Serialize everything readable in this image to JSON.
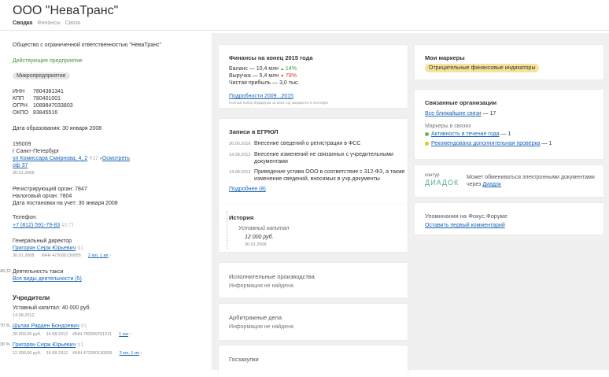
{
  "header": {
    "title": "ООО \"НеваТранс\"",
    "tabs": [
      "Сводка",
      "Финансы",
      "Связи"
    ]
  },
  "left": {
    "full_name": "Общество с ограниченной ответственностью \"НеваТранс\"",
    "status": "Действующее предприятие",
    "category": "Микропредприятие",
    "ids": [
      {
        "k": "ИНН",
        "v": "7804381341"
      },
      {
        "k": "КПП",
        "v": "780401001"
      },
      {
        "k": "ОГРН",
        "v": "1089847033803"
      },
      {
        "k": "ОКПО",
        "v": "83845516"
      }
    ],
    "formation_date": "Дата образования: 30 января 2008",
    "address": {
      "zip": "195009",
      "city": "г Санкт-Петербург",
      "street": "ул Комиссара Смирнова, 4, 2",
      "show": "Осмотреть",
      "office": "оф 37",
      "count": "17",
      "date": "30.01.2008"
    },
    "reg": {
      "reg_organ": "Регистрирующий орган: 7847",
      "tax_organ": "Налоговый орган: 7804",
      "tax_date": "Дата постановки на учет: 30 января 2008"
    },
    "phone": {
      "label": "Телефон:",
      "value": "+7 (812) 591-79-83",
      "count": "2"
    },
    "director": {
      "label": "Генеральный директор",
      "name": "Григорян Серж Юрьевич",
      "count": "1",
      "date": "30.01.2008",
      "inn": "ИНН 472000130055",
      "links": "2 юл, 1 ип"
    },
    "activity": {
      "pct": "49.32",
      "name": "Деятельность такси",
      "all": "Все виды деятельности (5)"
    },
    "founders": {
      "title": "Учредители",
      "capital": "Уставный капитал: 40 000 руб.",
      "date": "14.08.2012",
      "items": [
        {
          "pct": "70 %",
          "name": "Шулая Рарден Бондоевич",
          "count": "1",
          "sum": "28 000,00 руб.",
          "date": "14.08.2012",
          "inn": "ИНН 783909761211",
          "links": "1 юл"
        },
        {
          "pct": "30 %",
          "name": "Григорян Серж Юрьевич",
          "count": "1",
          "sum": "12 000,00 руб.",
          "date": "14.08.2012",
          "inn": "ИНН 472000130055",
          "links": "2 юл, 1 ип"
        }
      ]
    }
  },
  "finance": {
    "title": "Финансы на конец 2015 года",
    "rows": [
      {
        "label": "Баланс — 10,4 млн",
        "dir": "up",
        "delta": "14%"
      },
      {
        "label": "Выручка — 5,4 млн",
        "dir": "down",
        "delta": "78%"
      },
      {
        "label": "Чистая прибыль — 3,0 тыс.",
        "dir": "",
        "delta": ""
      }
    ],
    "details": "Подробности 2009...2015",
    "note": "Полный набор буфферов за 2016 год ожидается в сентябре"
  },
  "egrul": {
    "title": "Записи в ЕГРЮЛ",
    "rows": [
      {
        "date": "26.06.2016",
        "text": [
          "Внесение сведений о регистрации в ФСС"
        ]
      },
      {
        "date": "14.08.2012",
        "text": [
          "Внесение изменений не связанных с учредительными",
          "документами"
        ]
      },
      {
        "date": "14.08.2012",
        "text": [
          "Приведение устава ООО в соответствие с 312-ФЗ, а также",
          "изменение сведений, вносимых в учр.документы"
        ]
      }
    ],
    "more": "Подробнее (8)"
  },
  "history": {
    "title": "История",
    "label": "Уставный капитал",
    "value": "12 000 руб.",
    "date": "30.01.2008"
  },
  "enforcement": {
    "title": "Исполнительные производства",
    "text": "Информация не найдена"
  },
  "arbitration": {
    "title": "Арбитражные дела",
    "text": "Информация не найдена"
  },
  "procurement": {
    "title": "Госзакупки"
  },
  "markers": {
    "title": "Мои маркеры",
    "tag": "Отрицательные финансовые индикаторы"
  },
  "related": {
    "title": "Связанные организации",
    "nearest": "Все ближайшие связи",
    "nearest_count": "— 17",
    "markers_label": "Маркеры в связях",
    "items": [
      {
        "color": "#5cb85c",
        "text": "Активность в течение года",
        "count": "— 1"
      },
      {
        "color": "#e6c619",
        "text": "Рекомендована дополнительная проверка",
        "count": "— 1"
      }
    ]
  },
  "diadoc": {
    "logo_top": "контур",
    "logo_bottom": "ДИАДОК",
    "line1": "Может обмениваться электронными документами",
    "line2_prefix": "через",
    "line2_link": "Диадок"
  },
  "forum": {
    "title": "Упоминания на Фокус.Форуме",
    "link": "Оставить первый комментарий"
  }
}
